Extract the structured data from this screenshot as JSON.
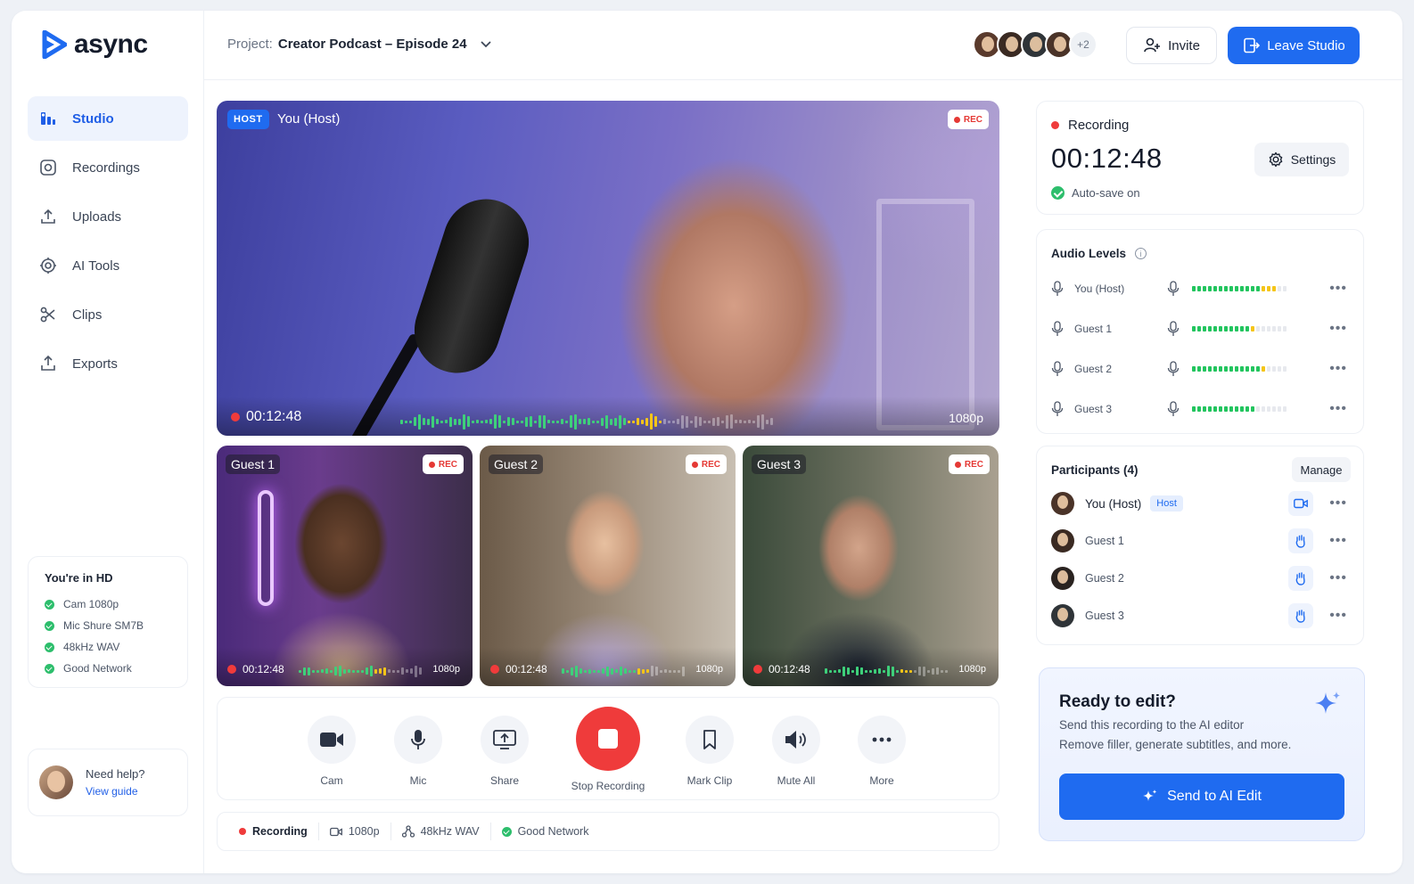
{
  "app": {
    "name": "async"
  },
  "sidebar": {
    "items": [
      {
        "label": "Studio",
        "icon": "studio-icon",
        "active": true
      },
      {
        "label": "Recordings",
        "icon": "recordings-icon"
      },
      {
        "label": "Uploads",
        "icon": "upload-icon"
      },
      {
        "label": "AI Tools",
        "icon": "ai-tools-icon"
      },
      {
        "label": "Clips",
        "icon": "scissors-icon"
      },
      {
        "label": "Exports",
        "icon": "export-icon"
      }
    ],
    "hd": {
      "title": "You're in HD",
      "items": [
        "Cam 1080p",
        "Mic Shure SM7B",
        "48kHz WAV",
        "Good Network"
      ]
    },
    "help": {
      "title": "Need help?",
      "link": "View guide"
    }
  },
  "header": {
    "project_label": "Project:",
    "project_name": "Creator Podcast – Episode 24",
    "participants_more": "+2",
    "invite": "Invite",
    "leave": "Leave Studio"
  },
  "main_video": {
    "badge": "HOST",
    "name": "You (Host)",
    "rec": "REC",
    "time": "00:12:48",
    "resolution": "1080p"
  },
  "guests": [
    {
      "name": "Guest 1",
      "rec": "REC",
      "time": "00:12:48",
      "resolution": "1080p"
    },
    {
      "name": "Guest 2",
      "rec": "REC",
      "time": "00:12:48",
      "resolution": "1080p"
    },
    {
      "name": "Guest 3",
      "rec": "REC",
      "time": "00:12:48",
      "resolution": "1080p"
    }
  ],
  "controls": {
    "cam": "Cam",
    "mic": "Mic",
    "share": "Share",
    "stop": "Stop Recording",
    "mark": "Mark Clip",
    "mute": "Mute All",
    "more": "More"
  },
  "status_bar": {
    "recording": "Recording",
    "video": "1080p",
    "audio": "48kHz WAV",
    "network": "Good Network"
  },
  "recording_card": {
    "label": "Recording",
    "time": "00:12:48",
    "settings": "Settings",
    "autosave": "Auto-save on"
  },
  "audio_levels": {
    "title": "Audio Levels",
    "rows": [
      {
        "name": "You (Host)",
        "green": 13,
        "yellow": 3
      },
      {
        "name": "Guest 1",
        "green": 11,
        "yellow": 1
      },
      {
        "name": "Guest 2",
        "green": 13,
        "yellow": 1
      },
      {
        "name": "Guest 3",
        "green": 12,
        "yellow": 0
      }
    ],
    "meter_segments": 18
  },
  "participants": {
    "title": "Participants (4)",
    "manage": "Manage",
    "host_tag": "Host",
    "rows": [
      {
        "name": "You (Host)"
      },
      {
        "name": "Guest 1"
      },
      {
        "name": "Guest 2"
      },
      {
        "name": "Guest 3"
      }
    ]
  },
  "edit_card": {
    "title": "Ready to edit?",
    "line1": "Send this recording to the AI editor",
    "line2": "Remove filler, generate subtitles, and more.",
    "button": "Send to AI Edit"
  },
  "colors": {
    "accent": "#1f6bf0",
    "record": "#ef3b3b",
    "ok": "#22c55e",
    "level_warn": "#f5c518"
  }
}
